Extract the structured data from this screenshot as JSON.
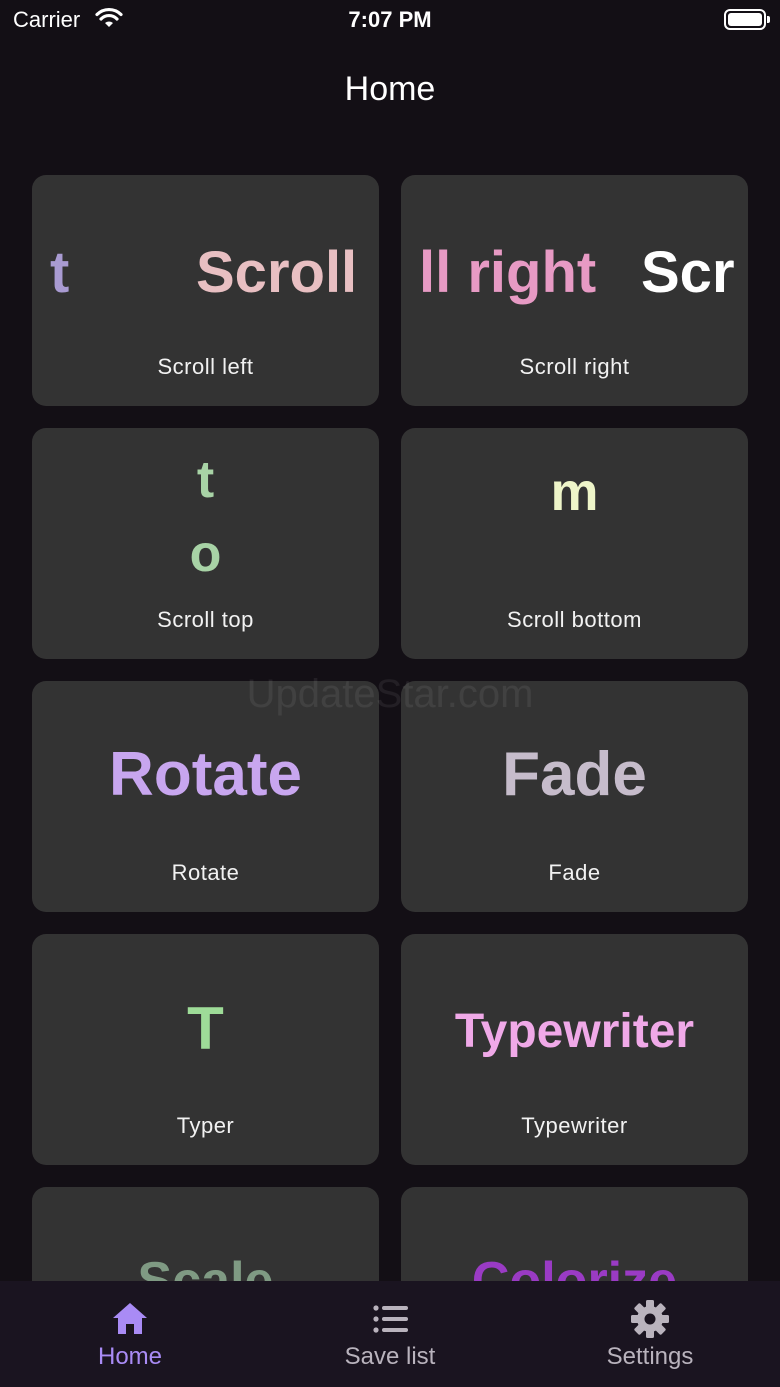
{
  "status_bar": {
    "carrier": "Carrier",
    "time": "7:07 PM"
  },
  "header": {
    "title": "Home"
  },
  "watermark": "UpdateStar.com",
  "cards": [
    {
      "label": "Scroll left",
      "demo_fragments": [
        "t",
        "Scroll"
      ]
    },
    {
      "label": "Scroll right",
      "demo_fragments": [
        "ll right",
        "Scr"
      ]
    },
    {
      "label": "Scroll top",
      "demo_fragments": [
        "t",
        "o"
      ]
    },
    {
      "label": "Scroll bottom",
      "demo_fragments": [
        "m"
      ]
    },
    {
      "label": "Rotate",
      "demo_fragments": [
        "Rotate"
      ]
    },
    {
      "label": "Fade",
      "demo_fragments": [
        "Fade"
      ]
    },
    {
      "label": "Typer",
      "demo_fragments": [
        "T"
      ]
    },
    {
      "label": "Typewriter",
      "demo_fragments": [
        "Typewriter"
      ]
    },
    {
      "label": "",
      "demo_fragments": [
        "Scale"
      ]
    },
    {
      "label": "",
      "demo_fragments": [
        "Colorize"
      ]
    }
  ],
  "tab_bar": {
    "tabs": [
      {
        "label": "Home",
        "icon": "home-icon",
        "active": true
      },
      {
        "label": "Save list",
        "icon": "list-icon",
        "active": false
      },
      {
        "label": "Settings",
        "icon": "gear-icon",
        "active": false
      }
    ]
  },
  "colors": {
    "background": "#130f15",
    "card": "#333333",
    "accent": "#a98bf5",
    "tab_inactive": "#b9b3bd"
  }
}
